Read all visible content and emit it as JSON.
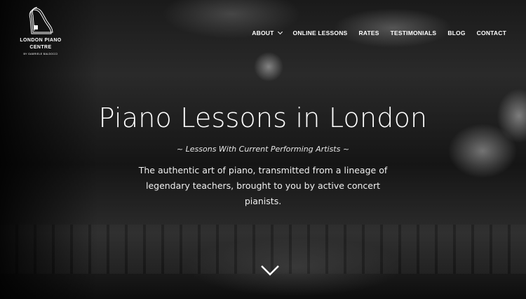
{
  "brand": {
    "name_line1": "LONDON PIANO",
    "name_line2": "CENTRE",
    "tagline": "BY GABRIELE BALDOCCI"
  },
  "nav": {
    "items": [
      {
        "label": "ABOUT",
        "has_dropdown": true
      },
      {
        "label": "ONLINE LESSONS"
      },
      {
        "label": "RATES"
      },
      {
        "label": "TESTIMONIALS"
      },
      {
        "label": "BLOG"
      },
      {
        "label": "CONTACT"
      }
    ]
  },
  "hero": {
    "title": "Piano Lessons in London",
    "subtitle": "~ Lessons With Current Performing Artists ~",
    "description": "The authentic art of piano, transmitted from a lineage of legendary teachers, brought to you by active concert pianists.",
    "scroll_icon": "chevron-down-icon"
  },
  "colors": {
    "text": "#ffffff",
    "background": "#000000"
  }
}
